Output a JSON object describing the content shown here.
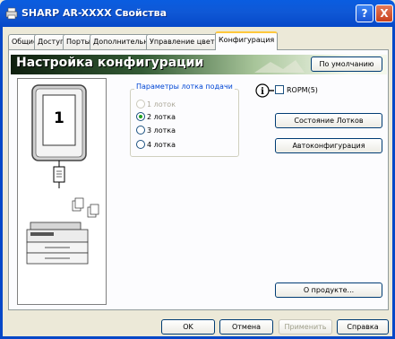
{
  "window": {
    "title": "SHARP AR-XXXX Свойства",
    "help_label": "?",
    "close_label": "X"
  },
  "tabs": [
    {
      "label": "Общие"
    },
    {
      "label": "Доступ"
    },
    {
      "label": "Порты"
    },
    {
      "label": "Дополнительно"
    },
    {
      "label": "Управление цветом"
    },
    {
      "label": "Конфигурация",
      "active": true
    }
  ],
  "banner": {
    "title": "Настройка конфигурации",
    "defaults_button": "По умолчанию"
  },
  "preview": {
    "tray_number": "1"
  },
  "tray_group": {
    "legend": "Параметры лотка подачи",
    "options": [
      {
        "label": "1 лоток",
        "state": "disabled"
      },
      {
        "label": "2 лотка",
        "state": "checked"
      },
      {
        "label": "3 лотка",
        "state": "unchecked"
      },
      {
        "label": "4 лотка",
        "state": "unchecked"
      }
    ]
  },
  "rspm": {
    "label": "ROPM(5)",
    "checked": false,
    "info_glyph": "i"
  },
  "buttons": {
    "tray_status": "Состояние Лотков",
    "auto_config": "Автоконфигурация",
    "about": "О продукте..."
  },
  "footer": {
    "ok": "OK",
    "cancel": "Отмена",
    "apply": "Применить",
    "help": "Справка"
  },
  "colors": {
    "titlebar": "#0648c8",
    "legend_text": "#0046d5",
    "radio_dot": "#21a121",
    "active_tab_accent": "#ffc83c"
  }
}
